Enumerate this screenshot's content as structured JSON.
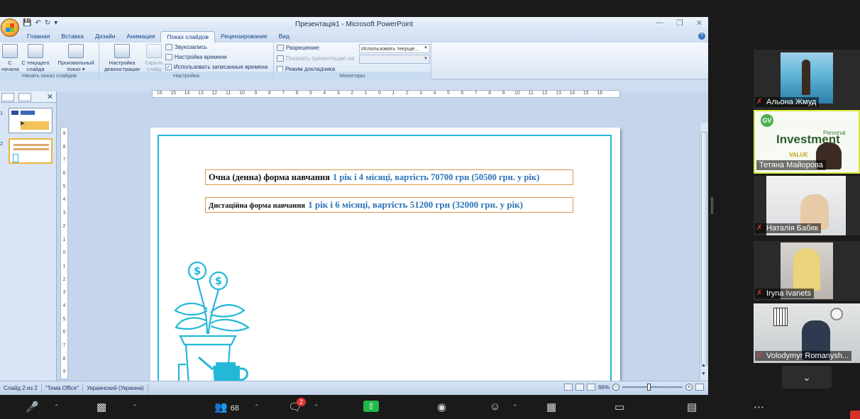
{
  "window": {
    "title": "Презентація1 - Microsoft PowerPoint"
  },
  "ribbon_tabs": [
    "Главная",
    "Вставка",
    "Дизайн",
    "Анимация",
    "Показ слайдов",
    "Рецензирование",
    "Вид"
  ],
  "active_tab": "Показ слайдов",
  "ribbon": {
    "start_group": {
      "label": "Начать показ слайдов",
      "from_beginning": "С начала",
      "from_current": "С текущего слайда",
      "custom_show": "Произвольный показ"
    },
    "setup_group": {
      "label": "Настройка",
      "setup_show": "Настройка демонстрации",
      "hide_slide": "Скрыть слайд",
      "record_narration": "Звукозапись",
      "rehearse_timings": "Настройка времени",
      "use_timings": "Использовать записанные времена"
    },
    "monitors_group": {
      "label": "Мониторы",
      "resolution_label": "Разрешение:",
      "resolution_value": "Использовать текуще...",
      "show_on_label": "Показать презентацию на:",
      "presenter_view": "Режим докладчика"
    }
  },
  "left_panel": {
    "slide_numbers": [
      "1",
      "2"
    ]
  },
  "hruler_ticks": [
    "16",
    "15",
    "14",
    "13",
    "12",
    "11",
    "10",
    "9",
    "8",
    "7",
    "6",
    "5",
    "4",
    "3",
    "2",
    "1",
    "0",
    "1",
    "2",
    "3",
    "4",
    "5",
    "6",
    "7",
    "8",
    "9",
    "10",
    "11",
    "12",
    "13",
    "14",
    "15",
    "16"
  ],
  "vruler_ticks": [
    "9",
    "8",
    "7",
    "6",
    "5",
    "4",
    "3",
    "2",
    "1",
    "0",
    "1",
    "2",
    "3",
    "4",
    "5",
    "6",
    "7",
    "8",
    "9"
  ],
  "slide": {
    "line1_label": "Очна (денна) форма навчання",
    "line1_value": "1 рік і 4 місяці, вартість 70700 грн (50500 грн. у рік)",
    "line2_label": "Дистаційна форма навчання",
    "line2_value": "1 рік і 6 місяці, вартість 51200 грн (32000 грн. у рік)",
    "accent_color": "#23b8d8",
    "value_color": "#2b73b8"
  },
  "status": {
    "slide_info": "Слайд 2 из 2",
    "theme": "\"Тема Office\"",
    "language": "Украинский (Украина)",
    "zoom": "66%"
  },
  "participants": [
    {
      "name": "Альона Жмуд"
    },
    {
      "name": "Тетяна Майорова"
    },
    {
      "name": "Наталія Бабяк"
    },
    {
      "name": "Iryna Ivanets"
    },
    {
      "name": "Volodymyr Romanysh..."
    }
  ],
  "wordcloud": {
    "main_word": "Investment",
    "personal": "Personal",
    "value": "VALUE"
  },
  "zoom_toolbar": {
    "participants_count": "68",
    "chat_badge": "2"
  }
}
